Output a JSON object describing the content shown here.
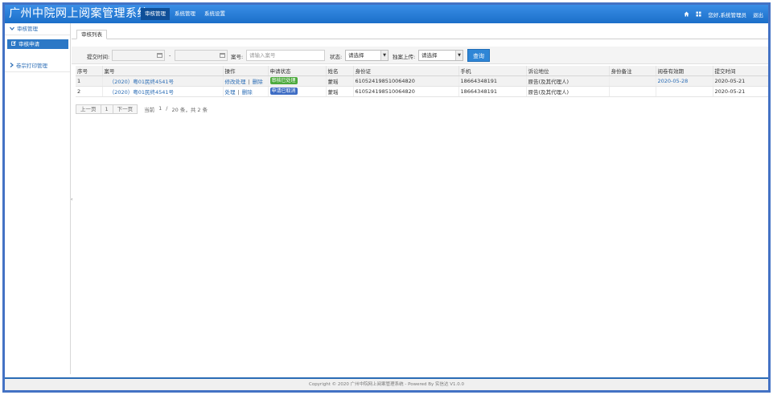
{
  "app": {
    "title": "广州中院网上阅案管理系统"
  },
  "topnav": [
    {
      "label": "审核管理"
    },
    {
      "label": "系统管理"
    },
    {
      "label": "系统设置"
    }
  ],
  "user": {
    "greeting": "您好,系统管理员",
    "logout": "退出"
  },
  "sidebar": {
    "groups": [
      {
        "label": "审核管理",
        "items": [
          {
            "label": "审核申请"
          }
        ]
      },
      {
        "label": "卷宗打印管理",
        "items": []
      }
    ]
  },
  "tabs": [
    {
      "label": "审核列表"
    }
  ],
  "filters": {
    "submit_time_label": "提交时间:",
    "range_sep": "-",
    "case_no_label": "案号:",
    "case_no_placeholder": "请输入案号",
    "status_label": "状态:",
    "status_value": "请选择",
    "upload_label": "独案上传:",
    "upload_value": "请选择",
    "query_button": "查询"
  },
  "table": {
    "columns": [
      "序号",
      "案号",
      "操作",
      "申请状态",
      "姓名",
      "身份证",
      "手机",
      "诉讼地位",
      "身份备注",
      "阅卷有效期",
      "提交时间"
    ],
    "rows": [
      {
        "index": "1",
        "case_no": "（2020）粤01民终4541号",
        "actions": [
          "修改处理",
          "删除"
        ],
        "status": "审核已处理",
        "status_color": "#4caa3c",
        "name": "蒙瑶",
        "id_card": "610524198510064820",
        "phone": "18664348191",
        "role": "原告(及其代理人)",
        "id_note": "",
        "valid_until": "2020-05-28",
        "submit_time": "2020-05-21"
      },
      {
        "index": "2",
        "case_no": "（2020）粤01民终4541号",
        "actions": [
          "处理",
          "删除"
        ],
        "status": "申请已取消",
        "status_color": "#3d6cc4",
        "name": "蒙瑶",
        "id_card": "610524198510064820",
        "phone": "18664348191",
        "role": "原告(及其代理人)",
        "id_note": "",
        "valid_until": "",
        "submit_time": "2020-05-21"
      }
    ]
  },
  "pager": {
    "prev": "上一页",
    "current": "1",
    "next": "下一页",
    "info_prefix": "当前",
    "page": "1",
    "slash": "/",
    "summary": "20 条，共 2 条"
  },
  "footer": {
    "text": "Copyright © 2020 广州中院网上阅案管理系统 - Powered By 实信达 V1.0.0"
  },
  "colors": {
    "header": "#1b6fc9",
    "accent": "#2c78c6",
    "badge_processed": "#4caa3c",
    "badge_cancelled": "#3d6cc4"
  },
  "icons": [
    "home-icon",
    "grid-icon",
    "chevron-down-icon",
    "chevron-right-icon",
    "edit-icon",
    "calendar-icon"
  ]
}
